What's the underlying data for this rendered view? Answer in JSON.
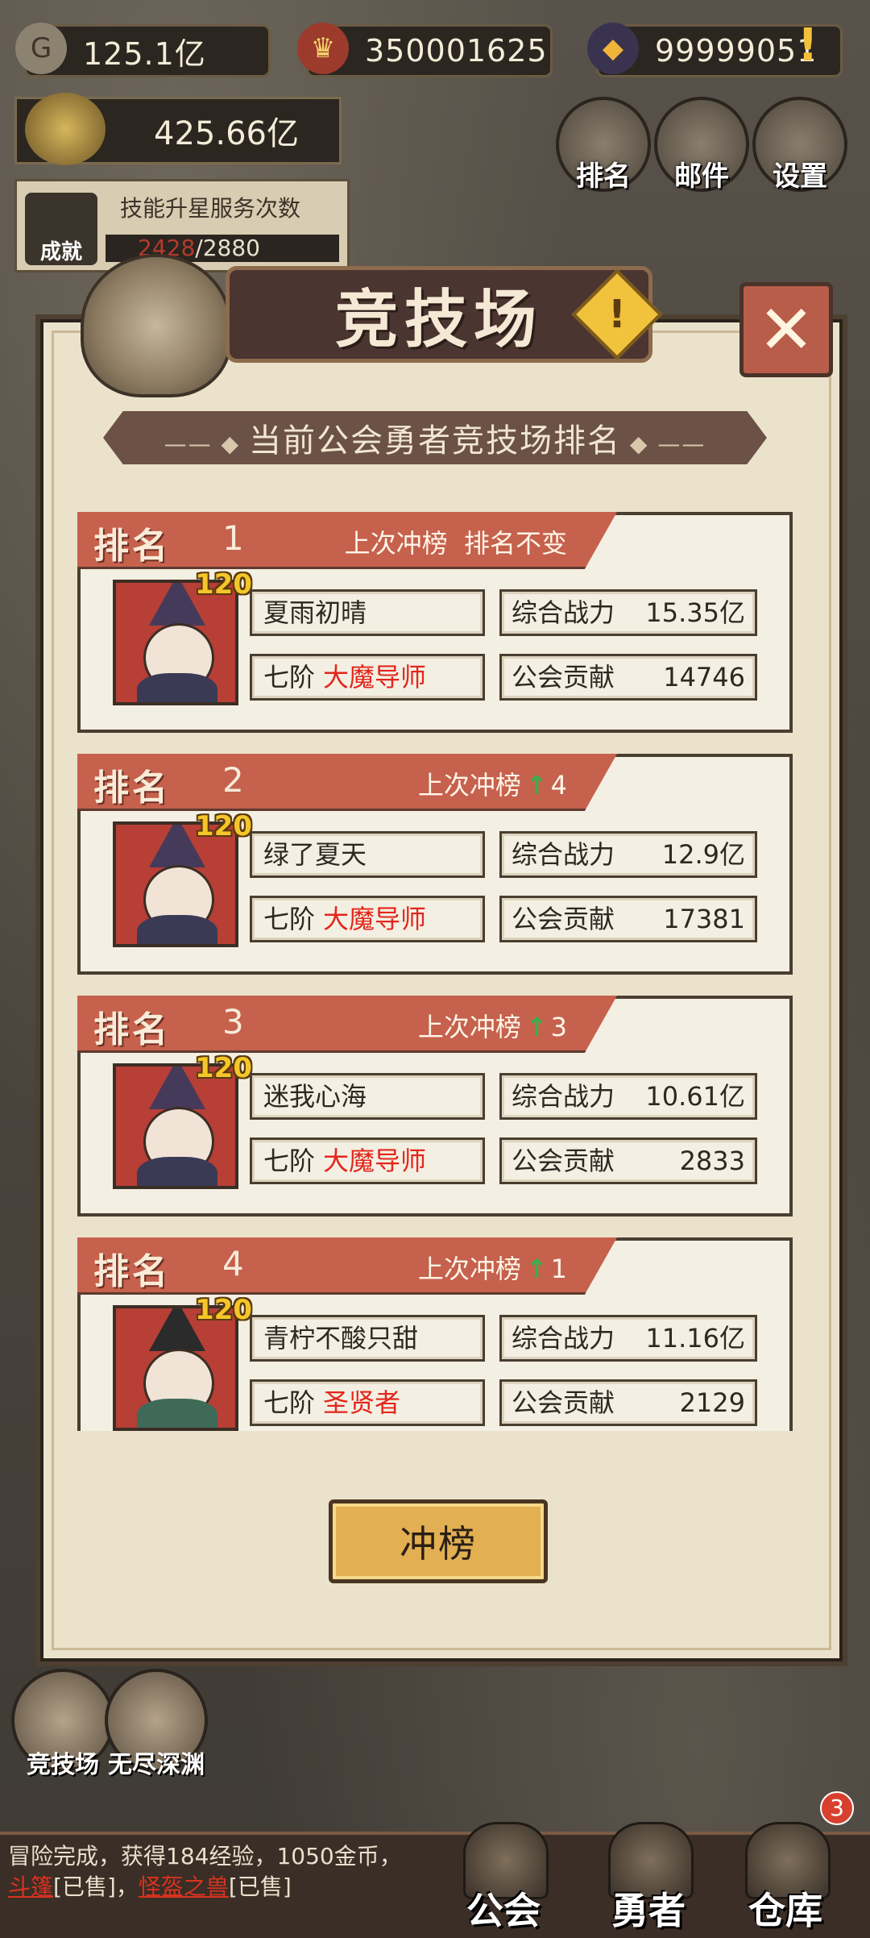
{
  "resources": {
    "gold": "125.1亿",
    "gems": "350001625",
    "crystal": "99999051",
    "total_power": "425.66亿"
  },
  "top_buttons": [
    {
      "label": "排名",
      "icon": "rank-icon"
    },
    {
      "label": "邮件",
      "icon": "mail-icon"
    },
    {
      "label": "设置",
      "icon": "gear-icon"
    }
  ],
  "skill_service": {
    "title": "技能升星服务次数",
    "used": "2428",
    "total": "/2880",
    "achievement_label": "成就"
  },
  "dialog": {
    "title": "竞技场",
    "subtitle": "当前公会勇者竞技场排名",
    "rank_label": "排名",
    "change_label": "上次冲榜",
    "power_label": "综合战力",
    "contrib_label": "公会贡献",
    "tier": "七阶",
    "action_button": "冲榜"
  },
  "rankings": [
    {
      "rank": "1",
      "change": "排名不变",
      "up": "",
      "level": "120",
      "name": "夏雨初晴",
      "class": "大魔导师",
      "power": "15.35亿",
      "contribution": "14746"
    },
    {
      "rank": "2",
      "change": "",
      "up": "4",
      "level": "120",
      "name": "绿了夏天",
      "class": "大魔导师",
      "power": "12.9亿",
      "contribution": "17381"
    },
    {
      "rank": "3",
      "change": "",
      "up": "3",
      "level": "120",
      "name": "迷我心海",
      "class": "大魔导师",
      "power": "10.61亿",
      "contribution": "2833"
    },
    {
      "rank": "4",
      "change": "",
      "up": "1",
      "level": "120",
      "name": "青柠不酸只甜",
      "class": "圣贤者",
      "power": "11.16亿",
      "contribution": "2129"
    }
  ],
  "side_buttons": [
    {
      "label": "竞技场"
    },
    {
      "label": "无尽深渊"
    }
  ],
  "bottom_nav": [
    {
      "label": "公会"
    },
    {
      "label": "勇者"
    },
    {
      "label": "仓库",
      "badge": "3"
    }
  ],
  "log": {
    "prefix": "冒险完成，获得184经验，1050金币，",
    "item1": "斗篷",
    "sold1": "[已售]，",
    "item2": "怪盔之兽",
    "sold2": "[已售]"
  },
  "colors": {
    "rank_banner": "#c5614d",
    "class_text": "#e3261b",
    "up_arrow": "#39b04d",
    "level_text": "#f5c629",
    "button_gold": "#e2b052"
  }
}
